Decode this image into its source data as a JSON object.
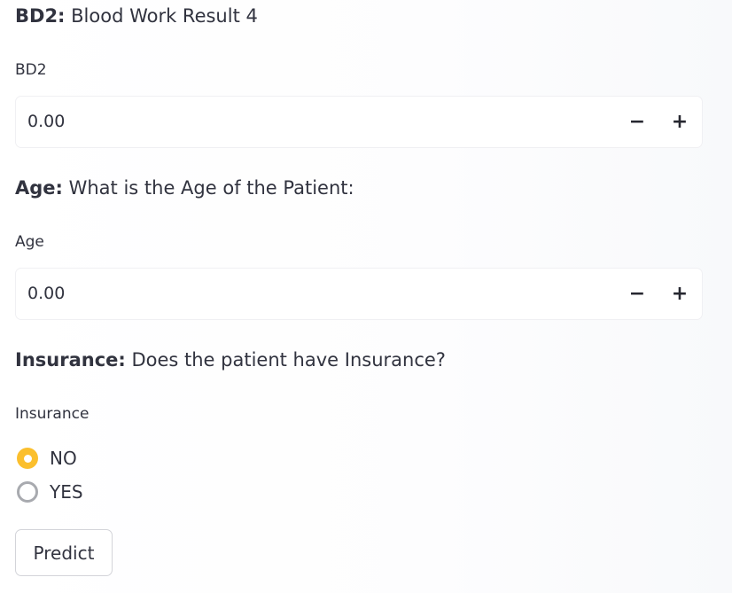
{
  "bd2": {
    "heading_key": "BD2:",
    "heading_text": " Blood Work Result 4",
    "label": "BD2",
    "value": "0.00",
    "minus": "−",
    "plus": "+"
  },
  "age": {
    "heading_key": "Age:",
    "heading_text": " What is the Age of the Patient:",
    "label": "Age",
    "value": "0.00",
    "minus": "−",
    "plus": "+"
  },
  "insurance": {
    "heading_key": "Insurance:",
    "heading_text": " Does the patient have Insurance?",
    "label": "Insurance",
    "options": [
      {
        "label": "NO",
        "selected": true
      },
      {
        "label": "YES",
        "selected": false
      }
    ]
  },
  "predict_button": "Predict",
  "colors": {
    "radio_selected": "#fbbf2d",
    "text": "#31333f"
  }
}
